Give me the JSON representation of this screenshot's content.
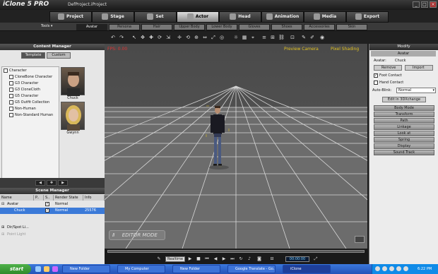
{
  "app": {
    "logo": "iClone 5 PRO",
    "title": "DefProject.iProject"
  },
  "top_tabs": [
    "Project",
    "Stage",
    "Set",
    "Actor",
    "Head",
    "Animation",
    "Media",
    "Export"
  ],
  "active_top_tab": "Actor",
  "tools_label": "Tools ▾",
  "sub_tabs": [
    "Avatar",
    "Persona",
    "Hair",
    "Upper Body",
    "Lower Body",
    "Gloves",
    "Shoes",
    "Accessories",
    "Skin"
  ],
  "active_sub_tab": "Avatar",
  "content_manager": {
    "title": "Content Manager",
    "tabs": [
      "Template",
      "Custom"
    ],
    "tree": [
      "Character",
      "CloneBone Character",
      "G3 Character",
      "G3 CloneCloth",
      "G5 Character",
      "G5 Outfit Collection",
      "Non-Human",
      "Non-Standard Human"
    ],
    "thumbs": [
      "Chuck",
      "Gwynn"
    ]
  },
  "scene_manager": {
    "title": "Scene Manager",
    "columns": [
      "Name",
      "P..",
      "S..",
      "Render State",
      "Info"
    ],
    "rows": [
      {
        "name": "Avatar",
        "render": "Normal",
        "info": ""
      },
      {
        "name": "Chuck",
        "render": "Normal",
        "info": "25576"
      },
      {
        "name": "Dir/Spot Li...",
        "render": "",
        "info": ""
      },
      {
        "name": "Point Light",
        "render": "",
        "info": ""
      }
    ]
  },
  "viewport": {
    "fps": "FPS: 0.00",
    "camera": "Preview Camera",
    "shading": "Pixel Shading",
    "mode": "EDITOR MODE"
  },
  "modify": {
    "title": "Modify",
    "section": "Avatar",
    "avatar_label": "Avatar:",
    "avatar_name": "Chuck",
    "remove": "Remove",
    "import": "Import",
    "foot_contact": "Foot Contact",
    "hand_contact": "Hand Contact",
    "autoblink_label": "Auto-Blink:",
    "autoblink_value": "Normal",
    "edit3d": "Edit in 3DXchange",
    "sections": [
      "Body Mode",
      "Transform",
      "Path",
      "Linkage",
      "Look at",
      "Spring",
      "Display",
      "Sound Track"
    ]
  },
  "timeline": {
    "realtime": "Realtime",
    "time": "00:00:00"
  },
  "taskbar": {
    "start": "start",
    "items": [
      "New Folder",
      "My Computer",
      "New Folder",
      "Google Translate - Go...",
      "iClone"
    ],
    "clock": "6:22 PM"
  }
}
